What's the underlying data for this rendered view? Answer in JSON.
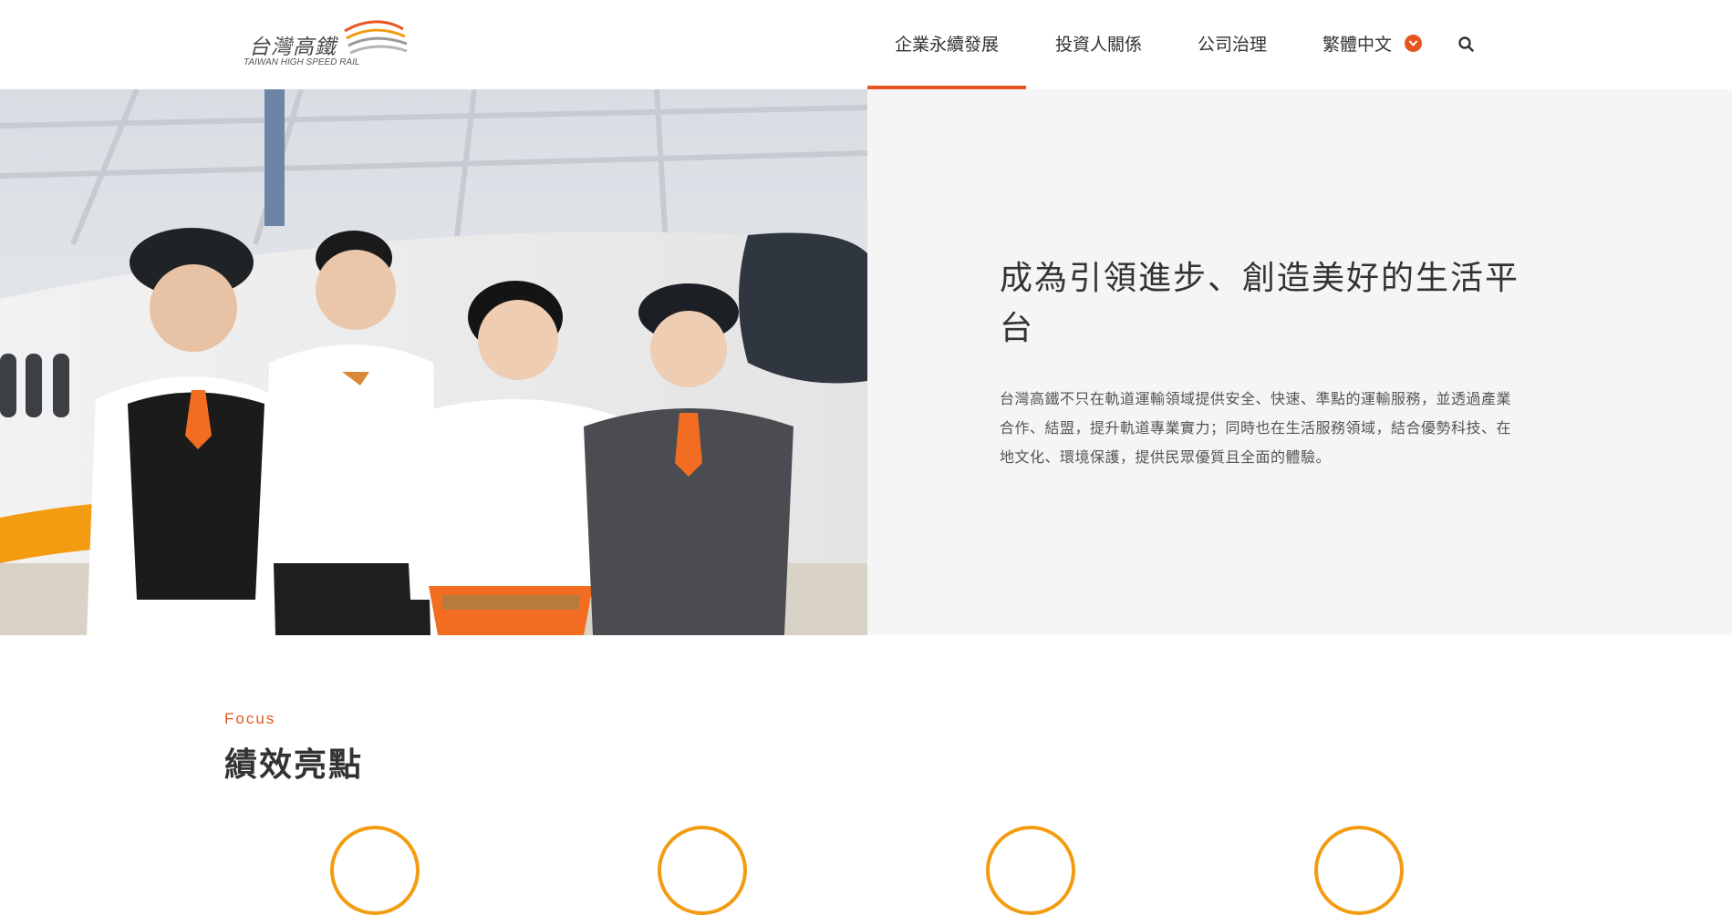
{
  "header": {
    "logo": {
      "cn": "台灣高鐵",
      "en": "TAIWAN HIGH SPEED RAIL"
    },
    "nav": [
      {
        "label": "企業永續發展",
        "active": true
      },
      {
        "label": "投資人關係",
        "active": false
      },
      {
        "label": "公司治理",
        "active": false
      },
      {
        "label": "繁體中文",
        "active": false
      }
    ],
    "icons": {
      "language_dropdown": "chevron-down-icon",
      "search": "search-icon"
    }
  },
  "hero": {
    "title": "成為引領進步、創造美好的生活平台",
    "description": "台灣高鐵不只在軌道運輸領域提供安全、快速、準點的運輸服務，並透過產業合作、結盟，提升軌道專業實力；同時也在生活服務領域，結合優勢科技、在地文化、環境保護，提供民眾優質且全面的體驗。"
  },
  "focus": {
    "kicker": "Focus",
    "title": "績效亮點"
  },
  "colors": {
    "accent": "#e8561f",
    "icon_ring": "#f39c12",
    "hero_bg": "#f5f5f5"
  }
}
